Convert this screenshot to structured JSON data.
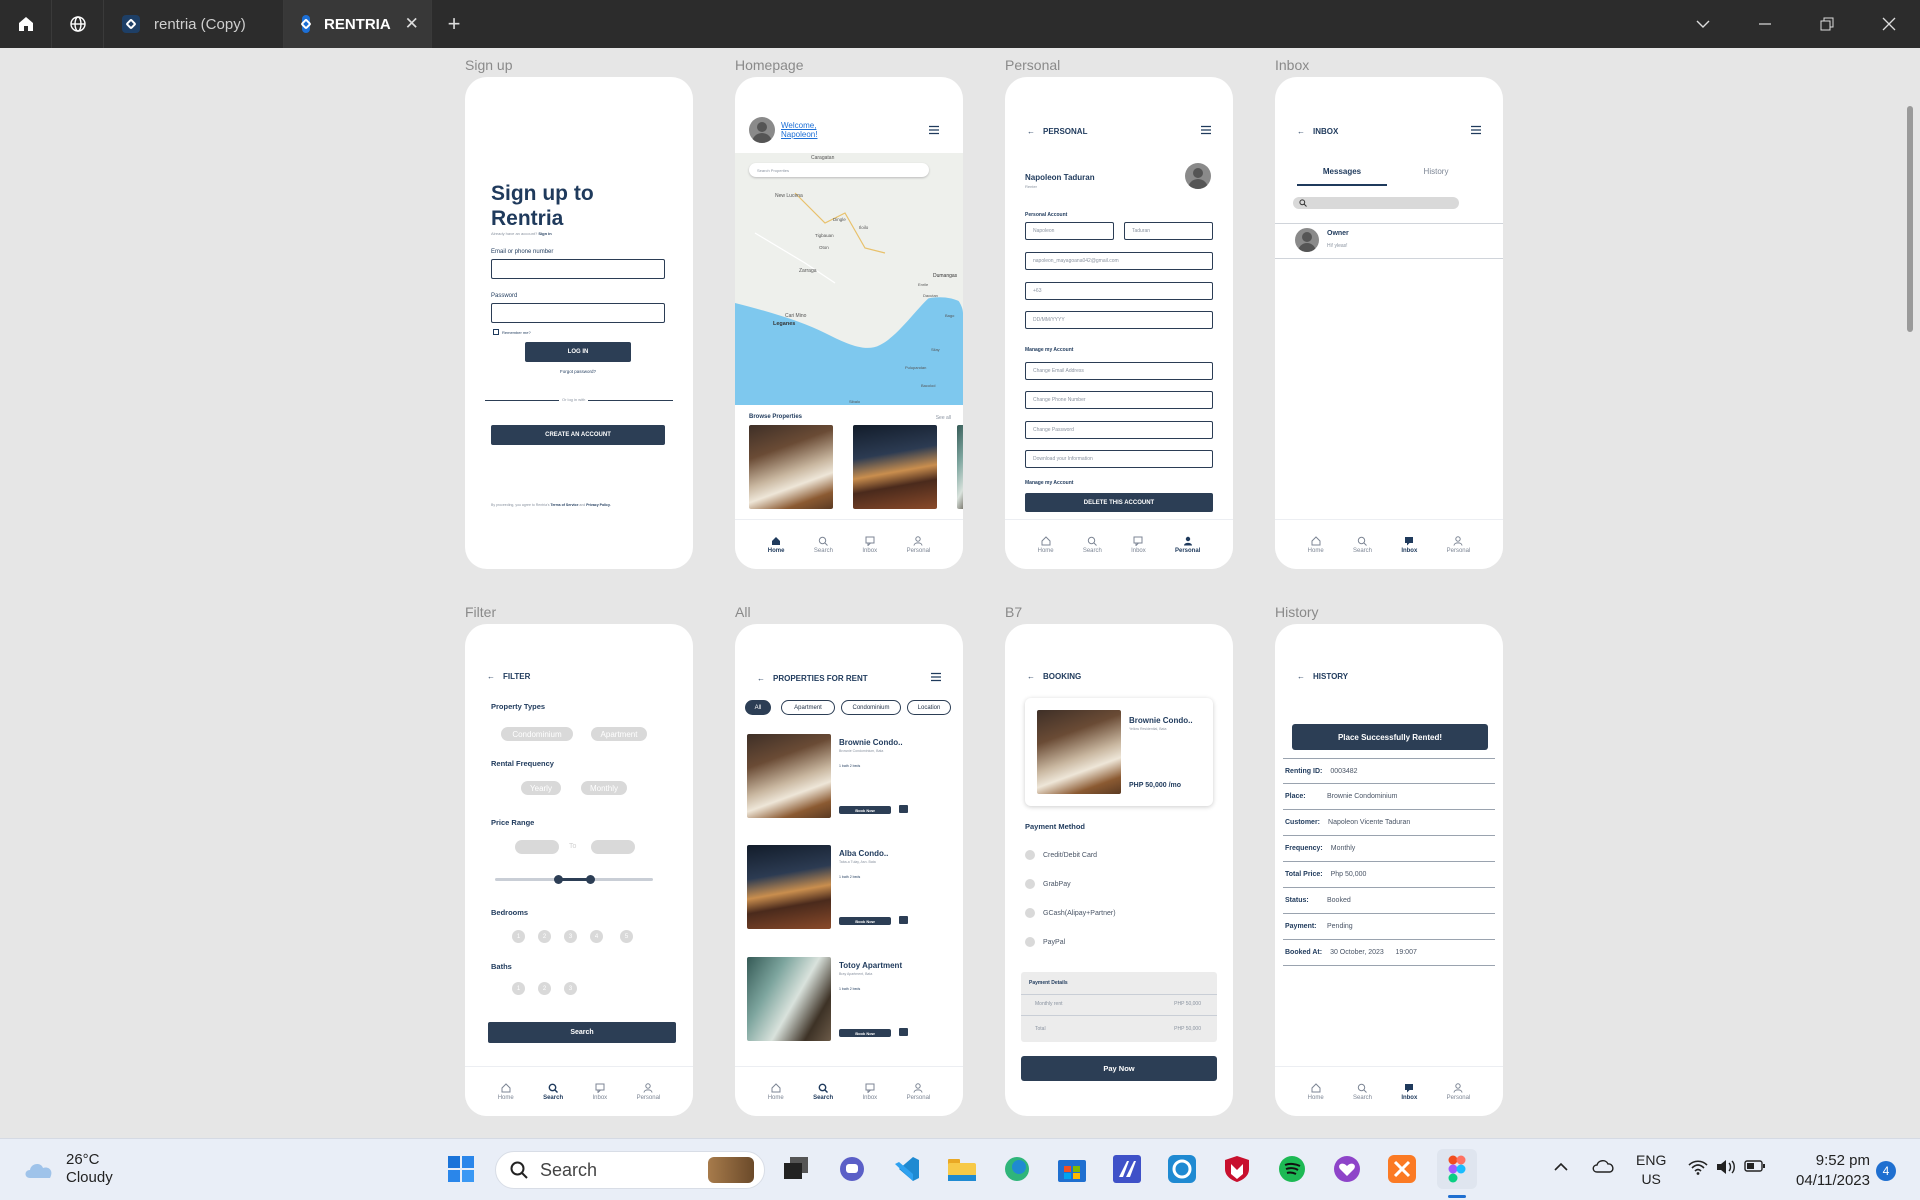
{
  "browser": {
    "tabs": [
      {
        "label": "rentria (Copy)",
        "active": false
      },
      {
        "label": "RENTRIA",
        "active": true
      }
    ]
  },
  "frames": {
    "signup": {
      "label": "Sign up",
      "title_line1": "Sign up to",
      "title_line2": "Rentria",
      "have_account": "Already have an account?",
      "sign_in": "Sign in",
      "email_label": "Email or phone number",
      "password_label": "Password",
      "remember": "Remember me?",
      "login": "LOG IN",
      "forgot": "Forgot password?",
      "or_login": "Or log in with",
      "create": "CREATE AN ACCOUNT",
      "terms_prefix": "By proceeding, you agree to Rentria's",
      "terms": "Terms of Service",
      "and": "and",
      "privacy": "Privacy Policy."
    },
    "homepage": {
      "label": "Homepage",
      "welcome_line1": "Welcome,",
      "welcome_line2": "Napoleon!",
      "search_placeholder": "Search Properties",
      "map_labels": [
        "Caragatan",
        "New Lucena",
        "Dingle",
        "Tigbauan",
        "Iloilo",
        "Oton",
        "Zarraga",
        "Cari Mino",
        "Leganes",
        "Dumangas",
        "Enrile",
        "Dacutan",
        "Bago",
        "Silay",
        "Bacolod",
        "Pulupandan",
        "Sibalo"
      ],
      "browse": "Browse Properties",
      "see_all": "See all"
    },
    "personal": {
      "label": "Personal",
      "header": "PERSONAL",
      "name": "Napoleon Taduran",
      "role": "Renter",
      "personal_account": "Personal Account",
      "first_name": "Napoleon",
      "last_name": "Taduran",
      "email": "napoleon_mayagoana042@gmail.com",
      "phone": "+63",
      "birth": "DD/MM/YYYY",
      "manage": "Manage my Account",
      "change_email": "Change Email Address",
      "change_phone": "Change Phone Number",
      "change_password": "Change Password",
      "download": "Download your Information",
      "manage2": "Manage my Account",
      "delete": "DELETE THIS ACCOUNT"
    },
    "inbox": {
      "label": "Inbox",
      "header": "INBOX",
      "tab_messages": "Messages",
      "tab_history": "History",
      "owner": "Owner",
      "message": "Hi! yleas!"
    },
    "filter": {
      "label": "Filter",
      "header": "FILTER",
      "property_types": "Property Types",
      "condominium": "Condominium",
      "apartment": "Apartment",
      "rental_frequency": "Rental Frequency",
      "yearly": "Yearly",
      "monthly": "Monthly",
      "price_range": "Price Range",
      "to": "To",
      "bedrooms": "Bedrooms",
      "bed_options": [
        "1",
        "2",
        "3",
        "4",
        "5"
      ],
      "baths": "Baths",
      "bath_options": [
        "1",
        "2",
        "3"
      ],
      "search": "Search"
    },
    "all": {
      "label": "All",
      "header": "PROPERTIES FOR RENT",
      "chips": [
        "All",
        "Apartment",
        "Condominium",
        "Location"
      ],
      "listings": [
        {
          "name": "Brownie Condo..",
          "address": "Brownie Condominium, Bata",
          "meta": "1 bath  2 beds",
          "book": "Book Now"
        },
        {
          "name": "Alba Condo..",
          "address": "Taba-a Tulay, Asn. Bata",
          "meta": "1 bath  2 beds",
          "book": "Book Now"
        },
        {
          "name": "Totoy Apartment",
          "address": "Bray Apartment, Bata",
          "meta": "1 bath  2 beds",
          "book": "Book Now"
        }
      ]
    },
    "b7": {
      "label": "B7",
      "header": "BOOKING",
      "property_name": "Brownie Condo..",
      "property_addr": "Yellow Residential, Bata",
      "price": "PHP 50,000 /mo",
      "payment_method": "Payment Method",
      "methods": [
        "Credit/Debit Card",
        "GrabPay",
        "GCash(Alipay+Partner)",
        "PayPal"
      ],
      "payment_details": "Payment Details",
      "monthly_rent": "Monthly rent",
      "monthly_rent_val": "PHP 50,000",
      "total": "Total",
      "total_val": "PHP 50,000",
      "pay_now": "Pay Now"
    },
    "history": {
      "label": "History",
      "header": "HISTORY",
      "banner": "Place Successfully Rented!",
      "rows": [
        {
          "k": "Renting ID:",
          "v": "0003482"
        },
        {
          "k": "Place:",
          "v": "Brownie Condominium"
        },
        {
          "k": "Customer:",
          "v": "Napoleon Vicente Taduran"
        },
        {
          "k": "Frequency:",
          "v": "Monthly"
        },
        {
          "k": "Total Price:",
          "v": "Php 50,000"
        },
        {
          "k": "Status:",
          "v": "Booked"
        },
        {
          "k": "Payment:",
          "v": "Pending"
        },
        {
          "k": "Booked At:",
          "v": "30 October, 2023      19:007"
        }
      ]
    }
  },
  "nav": {
    "home": "Home",
    "search": "Search",
    "inbox": "Inbox",
    "personal": "Personal"
  },
  "taskbar": {
    "temperature": "26°C",
    "weather": "Cloudy",
    "search_placeholder": "Search",
    "lang1": "ENG",
    "lang2": "US",
    "time": "9:52 pm",
    "date": "04/11/2023",
    "notifications": "4"
  },
  "colors": {
    "primary": "#2c3e55",
    "accent_blue": "#1c6fd6",
    "water": "#7ec8ee"
  }
}
